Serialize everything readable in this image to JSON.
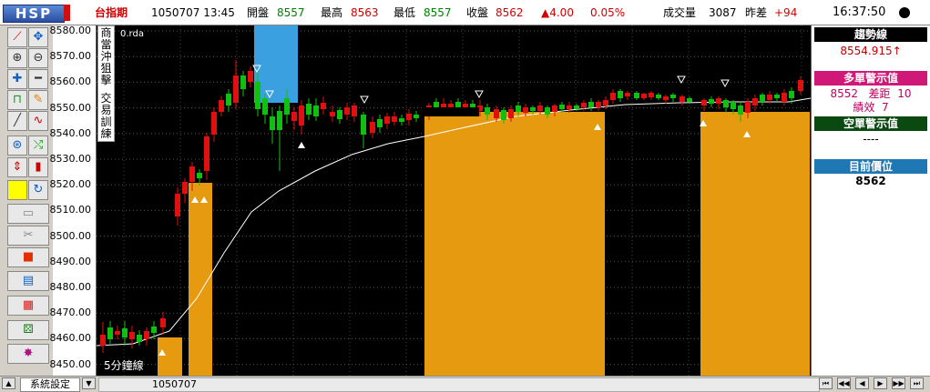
{
  "header": {
    "logo": "HSP",
    "product": "台指期",
    "date_time": "1050707  13:45",
    "open_label": "開盤",
    "open_value": "8557",
    "high_label": "最高",
    "high_value": "8563",
    "low_label": "最低",
    "low_value": "8557",
    "close_label": "收盤",
    "close_value": "8562",
    "change": "▲4.00",
    "change_pct": "0.05%",
    "volume_label": "成交量",
    "volume_value": "3087",
    "diff_label": "昨差",
    "diff_value": "+94",
    "clock": "16:37:50"
  },
  "toolbar": {
    "icons": [
      "draw-line-icon",
      "zoom-in-icon",
      "zoom-out-icon",
      "crosshair-icon",
      "lock-icon",
      "pencil-icon",
      "curve-icon",
      "formula-icon",
      "arrow-icon",
      "candle-icon",
      "color-icon",
      "refresh-icon",
      "folder-icon",
      "connector-icon",
      "stop-icon",
      "report-icon",
      "grid-icon",
      "dice-icon",
      "burst-icon"
    ]
  },
  "chart": {
    "side_menu": [
      "商",
      "當",
      "沖",
      "狙",
      "擊",
      "交",
      "易",
      "訓",
      "練"
    ],
    "unit_label": "0.rda",
    "period_label": "5分鐘線",
    "y_ticks": [
      "8580.00",
      "8570.00",
      "8560.00",
      "8550.00",
      "8540.00",
      "8530.00",
      "8520.00",
      "8510.00",
      "8500.00",
      "8490.00",
      "8480.00",
      "8470.00",
      "8460.00",
      "8450.00"
    ],
    "colors": {
      "up": "#e01010",
      "down": "#10c010",
      "orange": "#e69a10",
      "blue": "#3aa0e0",
      "line": "#ffffff"
    }
  },
  "right_panel": {
    "trend_title": "趨勢線",
    "trend_value": "8554.915↑",
    "long_title": "多單警示值",
    "long_value": "8552",
    "long_gap_label": "差距",
    "long_gap_value": "10",
    "long_perf_label": "績效",
    "long_perf_value": "7",
    "short_title": "空單警示值",
    "short_value": "----",
    "position_title": "目前價位",
    "position_value": "8562"
  },
  "status": {
    "settings_label": "系統設定",
    "date_label": "1050707",
    "nav_buttons": [
      "⏮",
      "◀◀",
      "◀",
      "▶",
      "▶▶",
      "⏭"
    ]
  }
}
